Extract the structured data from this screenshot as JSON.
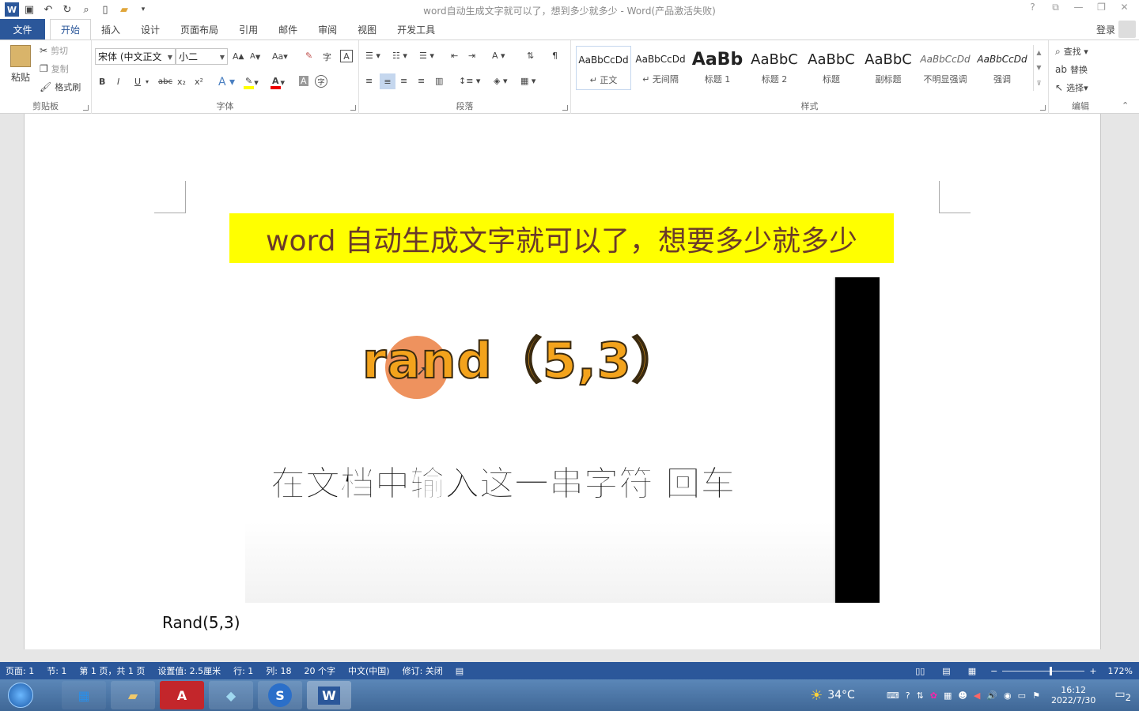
{
  "title": "word自动生成文字就可以了，想到多少就多少 - Word(产品激活失败)",
  "titlebar": {
    "icons": [
      "save-icon",
      "undo-icon",
      "redo-icon",
      "print-preview-icon",
      "new-icon",
      "open-icon",
      "customize-icon"
    ],
    "winbuttons": [
      "?",
      "⧉",
      "—",
      "❐",
      "✕"
    ]
  },
  "tabs": [
    "文件",
    "开始",
    "插入",
    "设计",
    "页面布局",
    "引用",
    "邮件",
    "审阅",
    "视图",
    "开发工具"
  ],
  "login": "登录",
  "clipboard": {
    "paste": "粘贴",
    "cut": "剪切",
    "copy": "复制",
    "format_painter": "格式刷",
    "label": "剪贴板"
  },
  "font": {
    "name": "宋体 (中文正文",
    "size": "小二",
    "grow": "A",
    "shrink": "A",
    "case": "Aa",
    "label": "字体"
  },
  "font_buttons": [
    "B",
    "I",
    "U",
    "abc",
    "x₂",
    "x²"
  ],
  "paragraph": {
    "label": "段落"
  },
  "styles": {
    "label": "样式",
    "items": [
      {
        "preview": "AaBbCcDd",
        "name": "↵ 正文"
      },
      {
        "preview": "AaBbCcDd",
        "name": "↵ 无间隔"
      },
      {
        "preview": "AaBb",
        "name": "标题 1"
      },
      {
        "preview": "AaBbC",
        "name": "标题 2"
      },
      {
        "preview": "AaBbC",
        "name": "标题"
      },
      {
        "preview": "AaBbC",
        "name": "副标题"
      },
      {
        "preview": "AaBbCcDd",
        "name": "不明显强调"
      },
      {
        "preview": "AaBbCcDd",
        "name": "强调"
      }
    ]
  },
  "editing": {
    "find": "查找",
    "replace": "替换",
    "select": "选择",
    "label": "编辑"
  },
  "document": {
    "heading": "word 自动生成文字就可以了，想要多少就多少",
    "video_formula": "rand（5,3）",
    "video_subtitle": "在文档中输入这一串字符 回车",
    "body": "Rand(5,3)"
  },
  "status": {
    "page": "页面: 1",
    "section": "节: 1",
    "pages": "第 1 页，共 1 页",
    "position": "设置值: 2.5厘米",
    "line": "行: 1",
    "column": "列: 18",
    "words": "20 个字",
    "language": "中文(中国)",
    "track": "修订: 关闭",
    "zoom": "172%"
  },
  "taskbar": {
    "apps": [
      "start",
      "file-explorer",
      "folder",
      "autocad",
      "notepad",
      "sogou",
      "word"
    ],
    "weather": "34°C",
    "time": "16:12",
    "date": "2022/7/30",
    "notifications": "2"
  },
  "colors": {
    "accent": "#2b579a",
    "highlight": "#ffff00",
    "heading_text": "#6a3a2a"
  }
}
